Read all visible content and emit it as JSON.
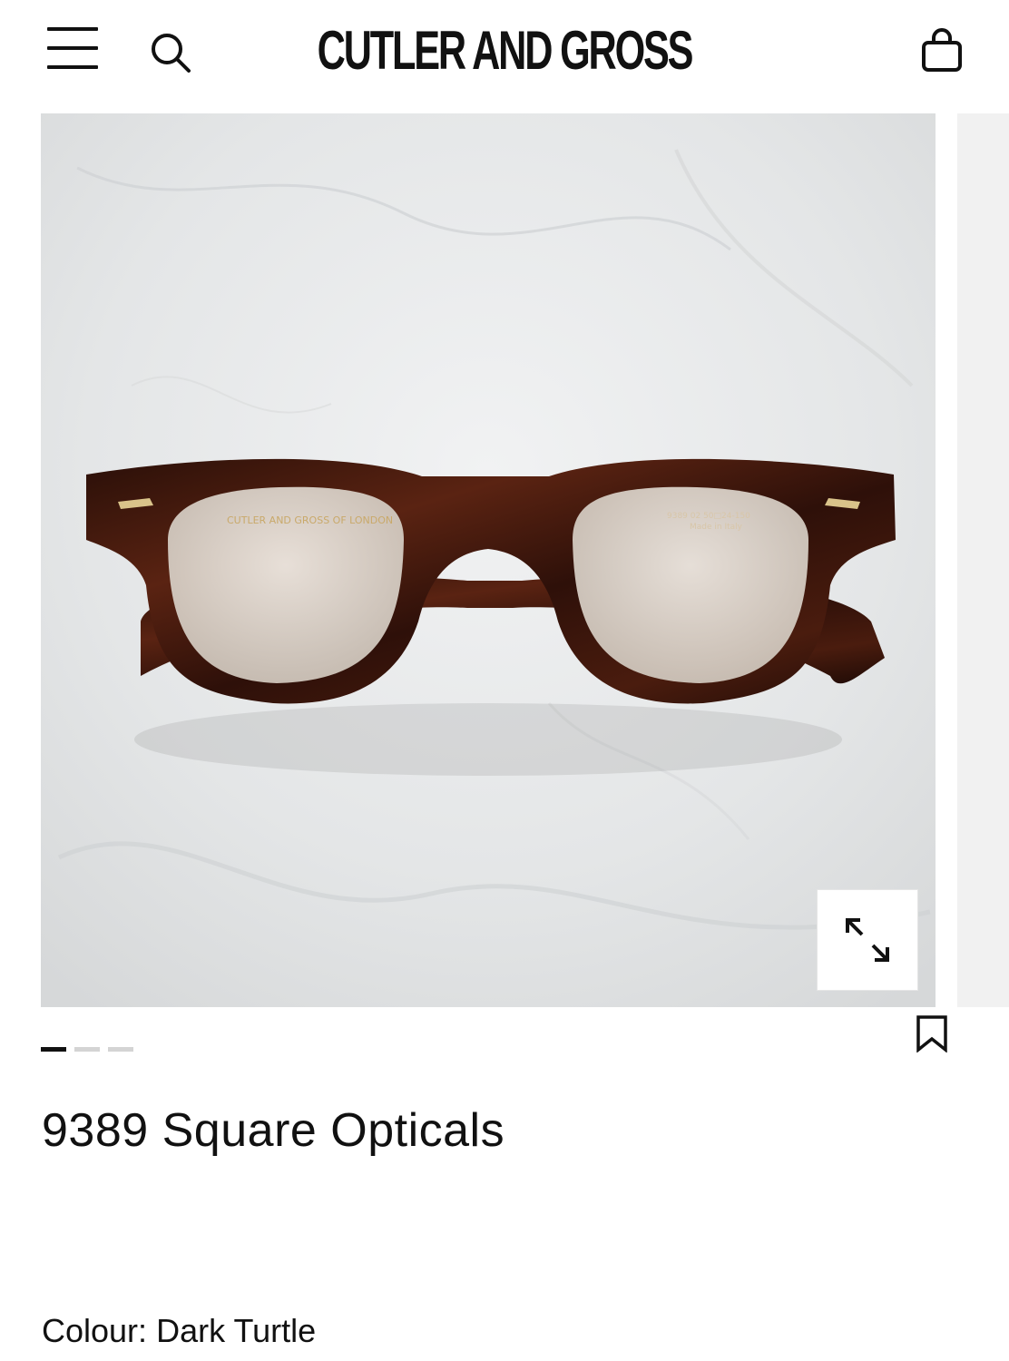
{
  "header": {
    "brand": "CUTLER AND GROSS",
    "menu_icon": "hamburger-menu-icon",
    "search_icon": "search-icon",
    "cart_icon": "shopping-bag-icon"
  },
  "gallery": {
    "image_alt": "9389 Square Opticals in Dark Turtle on marble",
    "temple_print_left": "CUTLER AND GROSS OF LONDON",
    "temple_print_right": "9389 02 50□24-150",
    "temple_print_right_2": "Made in Italy",
    "zoom_icon": "expand-arrows-icon",
    "slide_count": 3,
    "active_slide": 1
  },
  "product": {
    "title": "9389 Square Opticals",
    "colour_label": "Colour:",
    "colour_value": "Dark Turtle",
    "bookmark_icon": "bookmark-icon"
  },
  "colors": {
    "frame": "#3a160c",
    "marble": "#e8eaeb",
    "text": "#111111",
    "dot_active": "#111111",
    "dot_inactive": "#d4d4d4"
  }
}
